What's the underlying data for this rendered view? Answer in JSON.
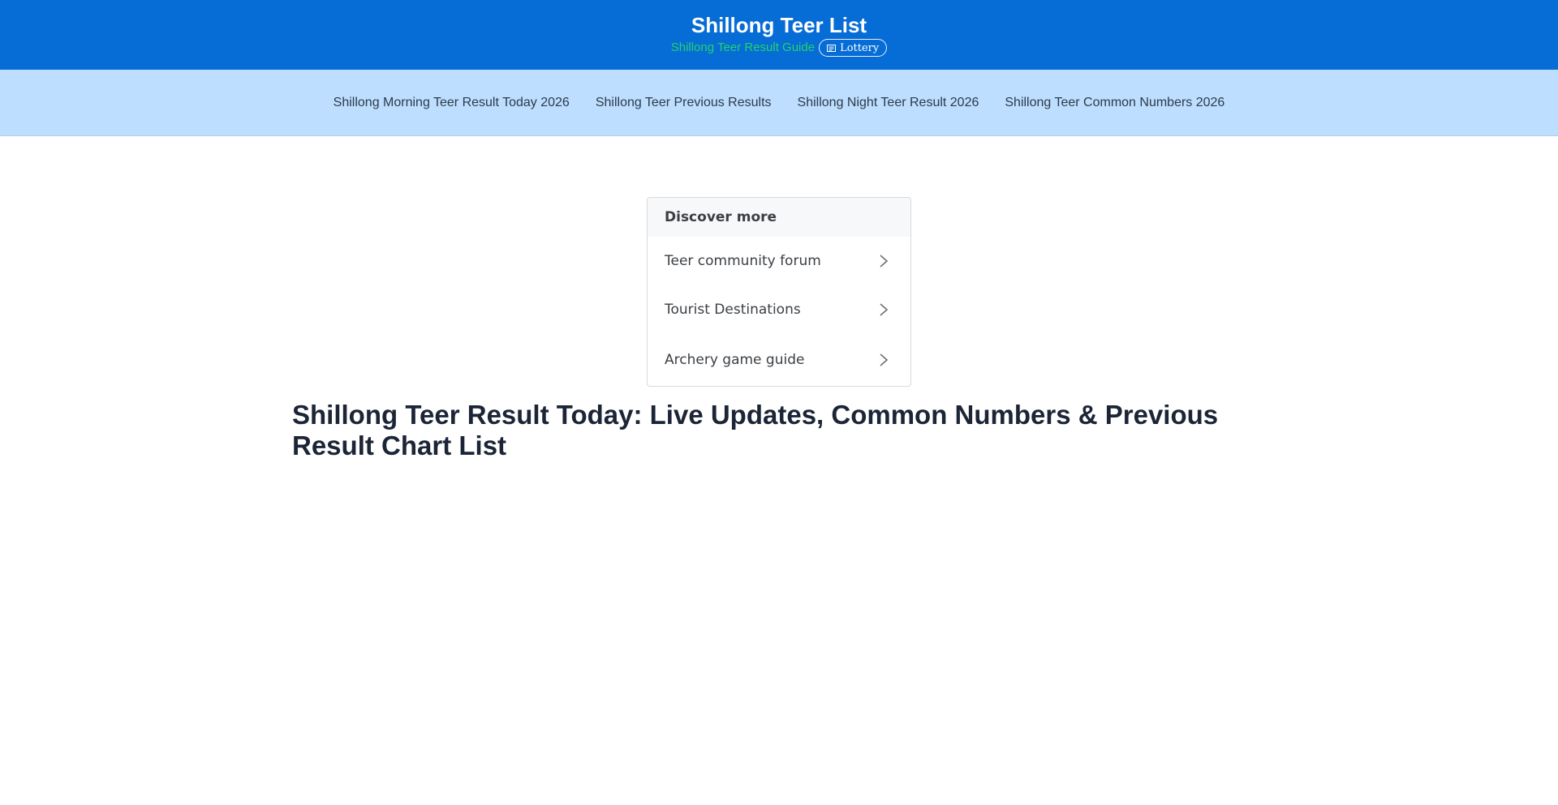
{
  "header": {
    "site_title": "Shillong Teer List",
    "tagline": "Shillong Teer Result Guide",
    "badge_label": "Lottery",
    "badge_icon": "newspaper-icon",
    "background_color": "#066cd6",
    "tagline_color": "#22d36b"
  },
  "nav": {
    "background_color": "#bddefe",
    "items": [
      {
        "label": "Shillong Morning Teer Result Today 2026"
      },
      {
        "label": "Shillong Teer Previous Results"
      },
      {
        "label": "Shillong Night Teer Result 2026"
      },
      {
        "label": "Shillong Teer Common Numbers 2026"
      }
    ]
  },
  "discover": {
    "heading": "Discover more",
    "items": [
      {
        "label": "Teer community forum",
        "icon": "chevron-right-icon"
      },
      {
        "label": "Tourist Destinations",
        "icon": "chevron-right-icon"
      },
      {
        "label": "Archery game guide",
        "icon": "chevron-right-icon"
      }
    ]
  },
  "article": {
    "title": "Shillong Teer Result Today: Live Updates, Common Numbers & Previous Result Chart List"
  }
}
